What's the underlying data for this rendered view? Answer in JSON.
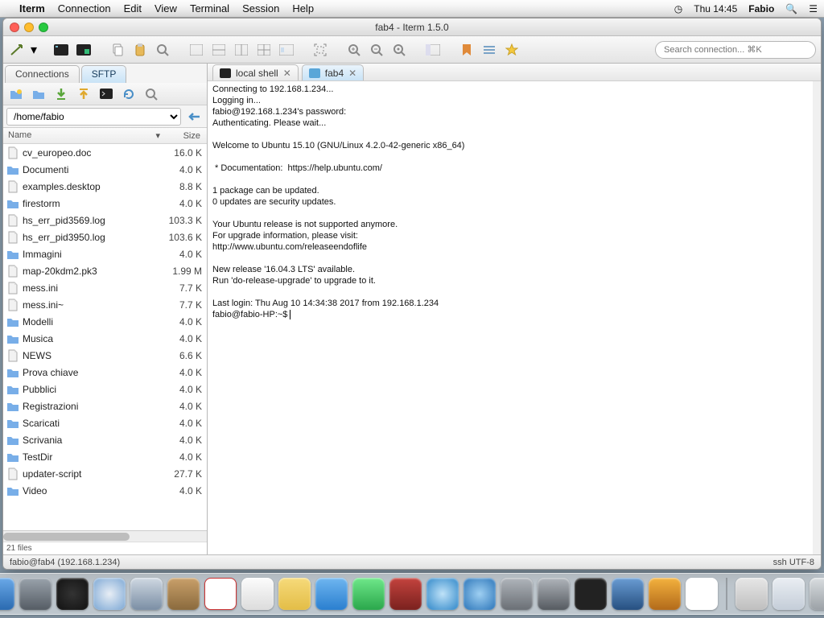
{
  "menubar": {
    "items": [
      "Iterm",
      "Connection",
      "Edit",
      "View",
      "Terminal",
      "Session",
      "Help"
    ],
    "time": "Thu 14:45",
    "user": "Fabio"
  },
  "window": {
    "title": "fab4 - Iterm 1.5.0"
  },
  "search": {
    "placeholder": "Search connection... ⌘K"
  },
  "side_tabs": {
    "items": [
      "Connections",
      "SFTP"
    ],
    "active": 1
  },
  "sftp": {
    "path": "/home/fabio",
    "files_footer": "21 files",
    "columns": {
      "name": "Name",
      "size": "Size"
    },
    "files": [
      {
        "name": "cv_europeo.doc",
        "size": "16.0 K",
        "type": "file"
      },
      {
        "name": "Documenti",
        "size": "4.0 K",
        "type": "folder"
      },
      {
        "name": "examples.desktop",
        "size": "8.8 K",
        "type": "file"
      },
      {
        "name": "firestorm",
        "size": "4.0 K",
        "type": "folder"
      },
      {
        "name": "hs_err_pid3569.log",
        "size": "103.3 K",
        "type": "file"
      },
      {
        "name": "hs_err_pid3950.log",
        "size": "103.6 K",
        "type": "file"
      },
      {
        "name": "Immagini",
        "size": "4.0 K",
        "type": "folder"
      },
      {
        "name": "map-20kdm2.pk3",
        "size": "1.99 M",
        "type": "file"
      },
      {
        "name": "mess.ini",
        "size": "7.7 K",
        "type": "file"
      },
      {
        "name": "mess.ini~",
        "size": "7.7 K",
        "type": "file"
      },
      {
        "name": "Modelli",
        "size": "4.0 K",
        "type": "folder"
      },
      {
        "name": "Musica",
        "size": "4.0 K",
        "type": "folder"
      },
      {
        "name": "NEWS",
        "size": "6.6 K",
        "type": "file"
      },
      {
        "name": "Prova chiave",
        "size": "4.0 K",
        "type": "folder"
      },
      {
        "name": "Pubblici",
        "size": "4.0 K",
        "type": "folder"
      },
      {
        "name": "Registrazioni",
        "size": "4.0 K",
        "type": "folder"
      },
      {
        "name": "Scaricati",
        "size": "4.0 K",
        "type": "folder"
      },
      {
        "name": "Scrivania",
        "size": "4.0 K",
        "type": "folder"
      },
      {
        "name": "TestDir",
        "size": "4.0 K",
        "type": "folder"
      },
      {
        "name": "updater-script",
        "size": "27.7 K",
        "type": "file"
      },
      {
        "name": "Video",
        "size": "4.0 K",
        "type": "folder"
      }
    ]
  },
  "term_tabs": {
    "items": [
      {
        "label": "local shell",
        "icon": "#222"
      },
      {
        "label": "fab4",
        "icon": "#5aa6d8"
      }
    ],
    "active": 1
  },
  "terminal": {
    "text": "Connecting to 192.168.1.234...\nLogging in...\nfabio@192.168.1.234's password:\nAuthenticating. Please wait...\n\nWelcome to Ubuntu 15.10 (GNU/Linux 4.2.0-42-generic x86_64)\n\n * Documentation:  https://help.ubuntu.com/\n\n1 package can be updated.\n0 updates are security updates.\n\nYour Ubuntu release is not supported anymore.\nFor upgrade information, please visit:\nhttp://www.ubuntu.com/releaseendoflife\n\nNew release '16.04.3 LTS' available.\nRun 'do-release-upgrade' to upgrade to it.\n\nLast login: Thu Aug 10 14:34:38 2017 from 192.168.1.234\nfabio@fabio-HP:~$ "
  },
  "status": {
    "left": "fabio@fab4 (192.168.1.234)",
    "right": "ssh  UTF-8"
  }
}
